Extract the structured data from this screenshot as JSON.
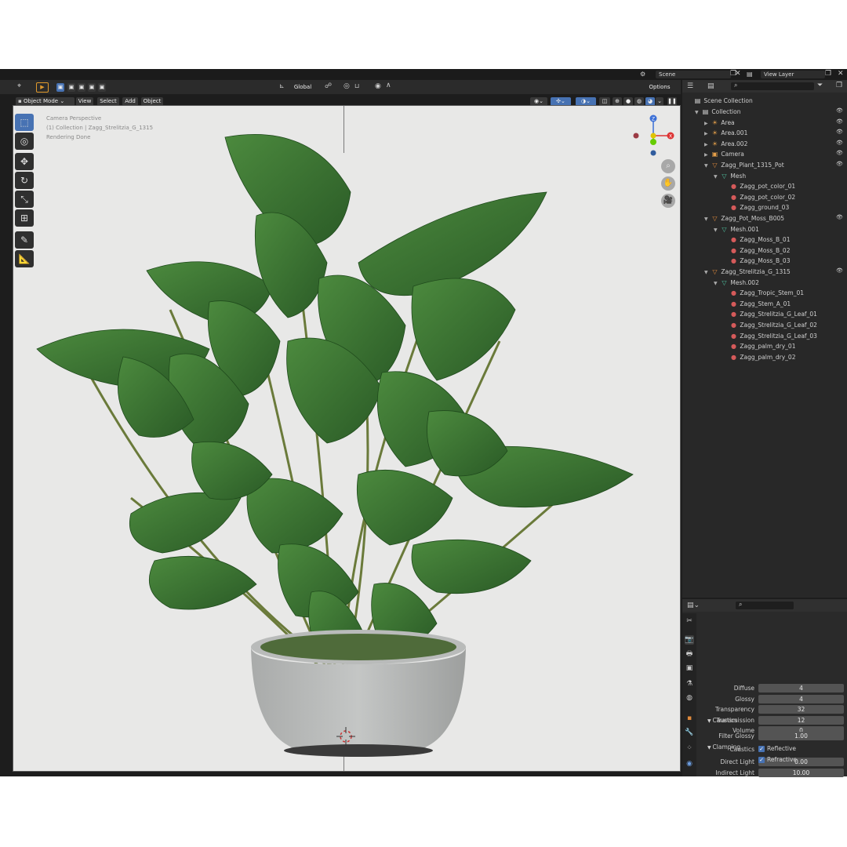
{
  "header": {
    "scene_label": "Scene",
    "view_layer_label": "View Layer"
  },
  "viewport_header": {
    "orientation": "Global",
    "options_label": "Options",
    "mode": "Object Mode",
    "menu": [
      "View",
      "Select",
      "Add",
      "Object"
    ]
  },
  "viewport": {
    "overlay_lines": [
      "Camera Perspective",
      "(1) Collection | Zagg_Strelitzia_G_1315",
      "Rendering Done"
    ],
    "gizmo_axes": {
      "z": "Z",
      "x": "X"
    }
  },
  "outliner": {
    "root": "Scene Collection",
    "items": [
      {
        "label": "Collection",
        "indent": 0,
        "icon": "collection-icon",
        "expand": "open",
        "eye": true
      },
      {
        "label": "Area",
        "indent": 1,
        "icon": "light-icon",
        "expand": "closed",
        "eye": true
      },
      {
        "label": "Area.001",
        "indent": 1,
        "icon": "light-icon",
        "expand": "closed",
        "eye": true
      },
      {
        "label": "Area.002",
        "indent": 1,
        "icon": "light-icon",
        "expand": "closed",
        "eye": true
      },
      {
        "label": "Camera",
        "indent": 1,
        "icon": "camera-icon",
        "expand": "closed",
        "eye": true
      },
      {
        "label": "Zagg_Plant_1315_Pot",
        "indent": 1,
        "icon": "object-icon",
        "expand": "open",
        "eye": true
      },
      {
        "label": "Mesh",
        "indent": 2,
        "icon": "mesh-icon",
        "expand": "open",
        "eye": false
      },
      {
        "label": "Zagg_pot_color_01",
        "indent": 3,
        "icon": "material-icon",
        "expand": "none",
        "eye": false
      },
      {
        "label": "Zagg_pot_color_02",
        "indent": 3,
        "icon": "material-icon",
        "expand": "none",
        "eye": false
      },
      {
        "label": "Zagg_ground_03",
        "indent": 3,
        "icon": "material-icon",
        "expand": "none",
        "eye": false
      },
      {
        "label": "Zagg_Pot_Moss_B005",
        "indent": 1,
        "icon": "object-icon",
        "expand": "open",
        "eye": true
      },
      {
        "label": "Mesh.001",
        "indent": 2,
        "icon": "mesh-icon",
        "expand": "open",
        "eye": false
      },
      {
        "label": "Zagg_Moss_B_01",
        "indent": 3,
        "icon": "material-icon",
        "expand": "none",
        "eye": false
      },
      {
        "label": "Zagg_Moss_B_02",
        "indent": 3,
        "icon": "material-icon",
        "expand": "none",
        "eye": false
      },
      {
        "label": "Zagg_Moss_B_03",
        "indent": 3,
        "icon": "material-icon",
        "expand": "none",
        "eye": false
      },
      {
        "label": "Zagg_Strelitzia_G_1315",
        "indent": 1,
        "icon": "object-icon",
        "expand": "open",
        "eye": true
      },
      {
        "label": "Mesh.002",
        "indent": 2,
        "icon": "mesh-icon",
        "expand": "open",
        "eye": false
      },
      {
        "label": "Zagg_Tropic_Stem_01",
        "indent": 3,
        "icon": "material-icon",
        "expand": "none",
        "eye": false
      },
      {
        "label": "Zagg_Stem_A_01",
        "indent": 3,
        "icon": "material-icon",
        "expand": "none",
        "eye": false
      },
      {
        "label": "Zagg_Strelitzia_G_Leaf_01",
        "indent": 3,
        "icon": "material-icon",
        "expand": "none",
        "eye": false
      },
      {
        "label": "Zagg_Strelitzia_G_Leaf_02",
        "indent": 3,
        "icon": "material-icon",
        "expand": "none",
        "eye": false
      },
      {
        "label": "Zagg_Strelitzia_G_Leaf_03",
        "indent": 3,
        "icon": "material-icon",
        "expand": "none",
        "eye": false
      },
      {
        "label": "Zagg_palm_dry_01",
        "indent": 3,
        "icon": "material-icon",
        "expand": "none",
        "eye": false
      },
      {
        "label": "Zagg_palm_dry_02",
        "indent": 3,
        "icon": "material-icon",
        "expand": "none",
        "eye": false
      }
    ]
  },
  "properties": {
    "bounces": [
      {
        "label": "Diffuse",
        "value": "4"
      },
      {
        "label": "Glossy",
        "value": "4"
      },
      {
        "label": "Transparency",
        "value": "32"
      },
      {
        "label": "Transmission",
        "value": "12"
      },
      {
        "label": "Volume",
        "value": "0"
      }
    ],
    "clamping": {
      "title": "Clamping",
      "direct_label": "Direct Light",
      "direct_value": "0.00",
      "indirect_label": "Indirect Light",
      "indirect_value": "10.00"
    },
    "caustics": {
      "title": "Caustics",
      "filter_label": "Filter Glossy",
      "filter_value": "1.00",
      "caustics_label": "Caustics",
      "reflective_label": "Reflective",
      "refractive_label": "Refractive"
    }
  },
  "colors": {
    "accent": "#4772b3",
    "panel": "#282828",
    "viewport_bg": "#e8e8e7"
  }
}
